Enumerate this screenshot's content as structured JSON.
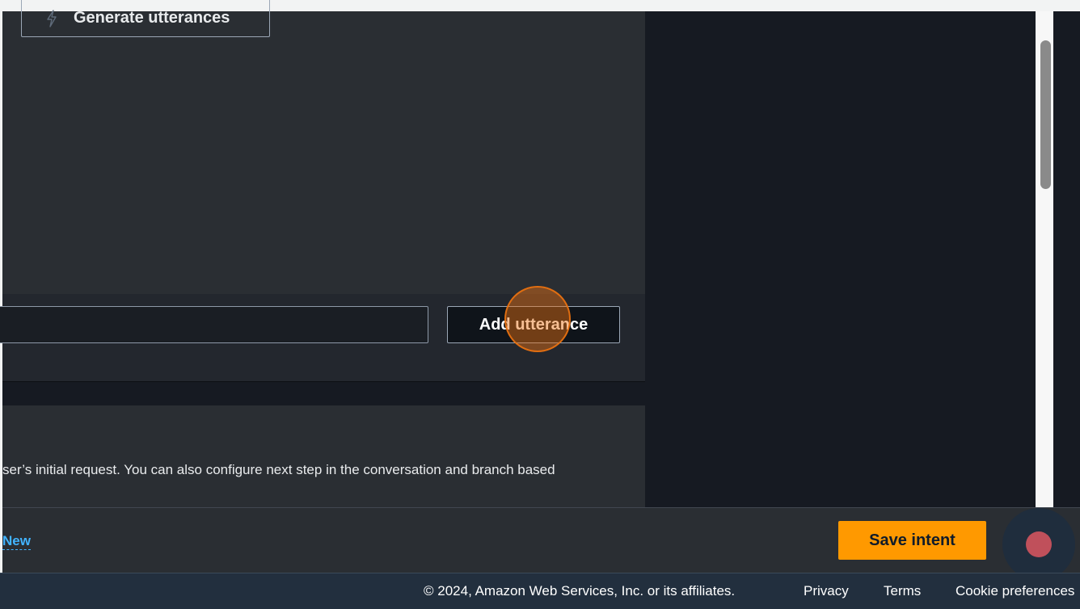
{
  "utterances_panel": {
    "generate_button_label": "Generate utterances",
    "generate_icon": "lightning-icon",
    "utterance_input_value": "",
    "add_button_label": "Add utterance"
  },
  "conversation_flow": {
    "description": "ser’s initial request. You can also configure next step in the conversation and branch based"
  },
  "bottom_bar": {
    "new_link_label": "New",
    "save_button_label": "Save intent",
    "record_icon": "record-icon"
  },
  "footer": {
    "copyright": "© 2024, Amazon Web Services, Inc. or its affiliates.",
    "links": [
      "Privacy",
      "Terms",
      "Cookie preferences"
    ]
  },
  "colors": {
    "primary_button": "#ff9900",
    "link": "#42b4ff",
    "click_indicator": "#ec7211",
    "panel": "#2a2e33",
    "background": "#161a22"
  }
}
